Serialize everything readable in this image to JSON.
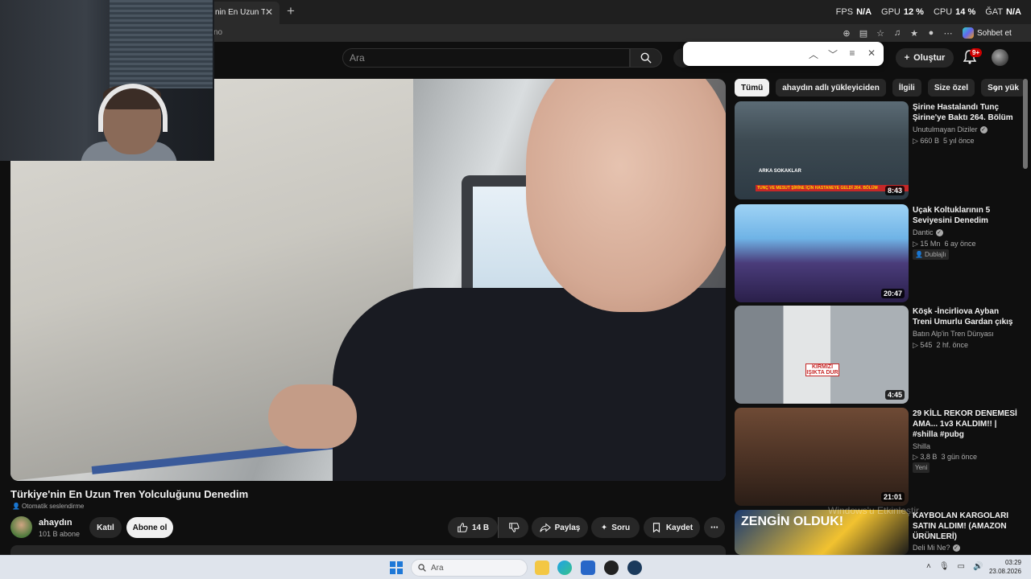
{
  "browser": {
    "tab_title": "nin En Uzun Tren",
    "url_fragment": "no",
    "perf": {
      "fps_label": "FPS",
      "fps_value": "N/A",
      "gpu_label": "GPU",
      "gpu_value": "12 %",
      "cpu_label": "CPU",
      "cpu_value": "14 %",
      "gat_label": "ĞAT",
      "gat_value": "N/A"
    },
    "copilot_label": "Sohbet et"
  },
  "header": {
    "search_placeholder": "Ara",
    "create_label": "Oluştur",
    "notif_count": "9+"
  },
  "video": {
    "title": "Türkiye'nin En Uzun Tren Yolculuğunu Denedim",
    "dub_label": "Otomatik seslendirme",
    "channel": "ahaydın",
    "subscribers": "101 B abone",
    "join_label": "Katıl",
    "subscribe_label": "Abone ol",
    "like_count": "14 B",
    "share_label": "Paylaş",
    "ask_label": "Soru",
    "save_label": "Kaydet"
  },
  "sidebar": {
    "chips": [
      "Tümü",
      "ahaydın adlı yükleyiciden",
      "İlgili",
      "Size özel",
      "Son yük"
    ],
    "items": [
      {
        "title": "Şirine Hastalandı Tunç Şirine'ye Baktı 264. Bölüm",
        "channel": "Unutulmayan Diziler",
        "verified": true,
        "views": "660 B",
        "age": "5 yıl önce",
        "duration": "8:43",
        "tag": ""
      },
      {
        "title": "Uçak Koltuklarının 5 Seviyesini Denedim",
        "channel": "Dantic",
        "verified": true,
        "views": "15 Mn",
        "age": "6 ay önce",
        "duration": "20:47",
        "tag": "Dublajlı"
      },
      {
        "title": "Köşk -İncirliova Ayban Treni Umurlu Gardan çıkış",
        "channel": "Batın Alp'in Tren Dünyası",
        "verified": false,
        "views": "545",
        "age": "2 hf. önce",
        "duration": "4:45",
        "tag": ""
      },
      {
        "title": "29 KİLL REKOR DENEMESİ AMA... 1v3 KALDIM!! | #shilla #pubg",
        "channel": "Shilla",
        "verified": false,
        "views": "3,8 B",
        "age": "3 gün önce",
        "duration": "21:01",
        "tag": "Yeni"
      },
      {
        "title": "KAYBOLAN KARGOLARI SATIN ALDIM! (AMAZON ÜRÜNLERİ)",
        "channel": "Deli Mi Ne?",
        "verified": true,
        "views": "",
        "age": "",
        "duration": "",
        "tag": ""
      }
    ],
    "thumb_texts": [
      "ARKA SOKAKLAR",
      "TUNÇ VE MESUT ŞİRİNE İÇİN HASTANEYE GELDİ 264. BÖLÜM",
      "KIRMIZI IŞIKTA DUR",
      "ZENGİN OLDUK!"
    ]
  },
  "watermark": "Windows'u Etkinleştir",
  "taskbar": {
    "search_placeholder": "Ara",
    "time": "03:29",
    "date": "23.08.2026"
  }
}
